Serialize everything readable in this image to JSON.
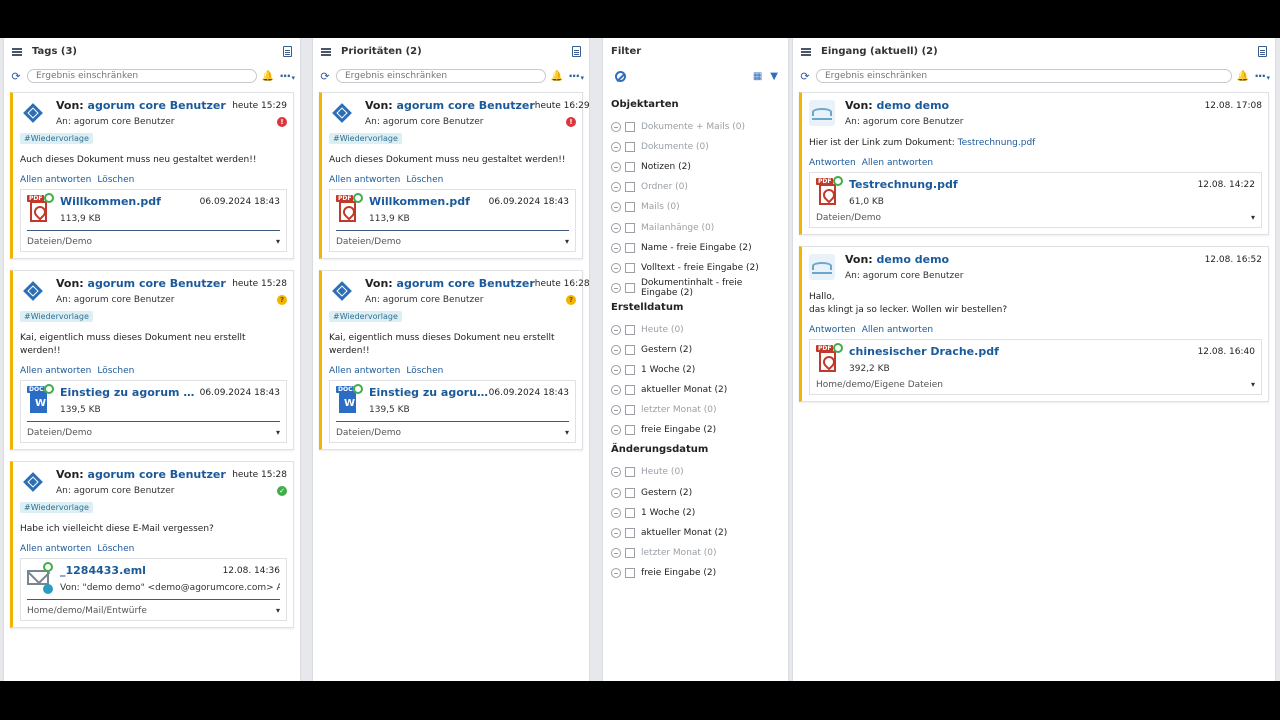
{
  "panels": {
    "tags": {
      "title": "Tags (3)",
      "search_placeholder": "Ergebnis einschränken",
      "cards": [
        {
          "from_label": "Von:",
          "from": "agorum core Benutzer",
          "time": "heute 15:29",
          "to": "An: agorum core Benutzer",
          "tag": "#Wiedervorlage",
          "text": "Auch dieses Dokument muss neu gestaltet werden!!",
          "act1": "Allen antworten",
          "act2": "Löschen",
          "status_color": "red",
          "status_glyph": "!",
          "att_name": "Willkommen.pdf",
          "att_date": "06.09.2024 18:43",
          "att_size": "113,9 KB",
          "att_type": "pdf",
          "att_label": "PDF",
          "path": "Dateien/Demo"
        },
        {
          "from_label": "Von:",
          "from": "agorum core Benutzer",
          "time": "heute 15:28",
          "to": "An: agorum core Benutzer",
          "tag": "#Wiedervorlage",
          "text": "Kai, eigentlich muss dieses Dokument neu erstellt werden!!",
          "act1": "Allen antworten",
          "act2": "Löschen",
          "status_color": "yellow",
          "status_glyph": "?",
          "att_name": "Einstieg zu agorum core....",
          "att_date": "06.09.2024 18:43",
          "att_size": "139,5 KB",
          "att_type": "word",
          "att_label": "DOCX",
          "path": "Dateien/Demo"
        },
        {
          "from_label": "Von:",
          "from": "agorum core Benutzer",
          "time": "heute 15:28",
          "to": "An: agorum core Benutzer",
          "tag": "#Wiedervorlage",
          "text": "Habe ich vielleicht diese E-Mail vergessen?",
          "act1": "Allen antworten",
          "act2": "Löschen",
          "status_color": "green",
          "status_glyph": "✓",
          "att_name": "_1284433.eml",
          "att_date": "12.08. 14:36",
          "att_size": "Von: \"demo demo\" <demo@agorumcore.com> An:",
          "att_type": "mail",
          "att_label": "",
          "path": "Home/demo/Mail/Entwürfe"
        }
      ]
    },
    "prioritaeten": {
      "title": "Prioritäten (2)",
      "search_placeholder": "Ergebnis einschränken",
      "cards": [
        {
          "from_label": "Von:",
          "from": "agorum core Benutzer",
          "time": "heute 16:29",
          "to": "An: agorum core Benutzer",
          "tag": "#Wiedervorlage",
          "text": "Auch dieses Dokument muss neu gestaltet werden!!",
          "act1": "Allen antworten",
          "act2": "Löschen",
          "status_color": "red",
          "status_glyph": "!",
          "att_name": "Willkommen.pdf",
          "att_date": "06.09.2024 18:43",
          "att_size": "113,9 KB",
          "att_type": "pdf",
          "att_label": "PDF",
          "path": "Dateien/Demo"
        },
        {
          "from_label": "Von:",
          "from": "agorum core Benutzer",
          "time": "heute 16:28",
          "to": "An: agorum core Benutzer",
          "tag": "#Wiedervorlage",
          "text": "Kai, eigentlich muss dieses Dokument neu erstellt werden!!",
          "act1": "Allen antworten",
          "act2": "Löschen",
          "status_color": "yellow",
          "status_glyph": "?",
          "att_name": "Einstieg zu agorum c...",
          "att_date": "06.09.2024 18:43",
          "att_size": "139,5 KB",
          "att_type": "word",
          "att_label": "DOCX",
          "path": "Dateien/Demo"
        }
      ]
    },
    "filter": {
      "title": "Filter",
      "sections": [
        {
          "title": "Objektarten",
          "items": [
            {
              "label": "Dokumente + Mails (0)",
              "enabled": false
            },
            {
              "label": "Dokumente (0)",
              "enabled": false
            },
            {
              "label": "Notizen (2)",
              "enabled": true
            },
            {
              "label": "Ordner (0)",
              "enabled": false
            },
            {
              "label": "Mails (0)",
              "enabled": false
            },
            {
              "label": "Mailanhänge (0)",
              "enabled": false
            },
            {
              "label": "Name - freie Eingabe (2)",
              "enabled": true
            },
            {
              "label": "Volltext - freie Eingabe (2)",
              "enabled": true
            },
            {
              "label": "Dokumentinhalt - freie Eingabe (2)",
              "enabled": true
            }
          ]
        },
        {
          "title": "Erstelldatum",
          "items": [
            {
              "label": "Heute (0)",
              "enabled": false
            },
            {
              "label": "Gestern (2)",
              "enabled": true
            },
            {
              "label": "1 Woche (2)",
              "enabled": true
            },
            {
              "label": "aktueller Monat (2)",
              "enabled": true
            },
            {
              "label": "letzter Monat (0)",
              "enabled": false
            },
            {
              "label": "freie Eingabe (2)",
              "enabled": true
            }
          ]
        },
        {
          "title": "Änderungsdatum",
          "items": [
            {
              "label": "Heute (0)",
              "enabled": false
            },
            {
              "label": "Gestern (2)",
              "enabled": true
            },
            {
              "label": "1 Woche (2)",
              "enabled": true
            },
            {
              "label": "aktueller Monat (2)",
              "enabled": true
            },
            {
              "label": "letzter Monat (0)",
              "enabled": false
            },
            {
              "label": "freie Eingabe (2)",
              "enabled": true
            }
          ]
        }
      ]
    },
    "eingang": {
      "title": "Eingang (aktuell) (2)",
      "search_placeholder": "Ergebnis einschränken",
      "cards": [
        {
          "from_label": "Von:",
          "from": "demo demo",
          "time": "12.08. 17:08",
          "to": "An: agorum core Benutzer",
          "text1": "Hier ist der Link zum Dokument: ",
          "link": "Testrechnung.pdf",
          "text2": "",
          "act1": "Antworten",
          "act2": "Allen antworten",
          "att_name": "Testrechnung.pdf",
          "att_date": "12.08. 14:22",
          "att_size": "61,0 KB",
          "att_type": "pdf",
          "att_label": "PDF",
          "path": "Dateien/Demo"
        },
        {
          "from_label": "Von:",
          "from": "demo demo",
          "time": "12.08. 16:52",
          "to": "An: agorum core Benutzer",
          "text1": "Hallo,",
          "link": "",
          "text2": "das klingt ja so lecker. Wollen wir bestellen?",
          "act1": "Antworten",
          "act2": "Allen antworten",
          "att_name": "chinesischer Drache.pdf",
          "att_date": "12.08. 16:40",
          "att_size": "392,2 KB",
          "att_type": "pdf",
          "att_label": "PDF",
          "path": "Home/demo/Eigene Dateien"
        }
      ]
    }
  },
  "colors": {
    "accent": "#1b5a9a",
    "card_border": "#f2b400",
    "red": "#d9363e",
    "yellow": "#f2b400",
    "green": "#3fae49"
  },
  "icons": [
    "menu-icon",
    "document-list-icon",
    "refresh-icon",
    "bell-icon",
    "more-icon",
    "filter-clear-icon",
    "filter-icon",
    "minus-circle-icon",
    "checkbox-icon",
    "chevron-down-icon",
    "pdf-icon",
    "word-icon",
    "mail-icon"
  ]
}
